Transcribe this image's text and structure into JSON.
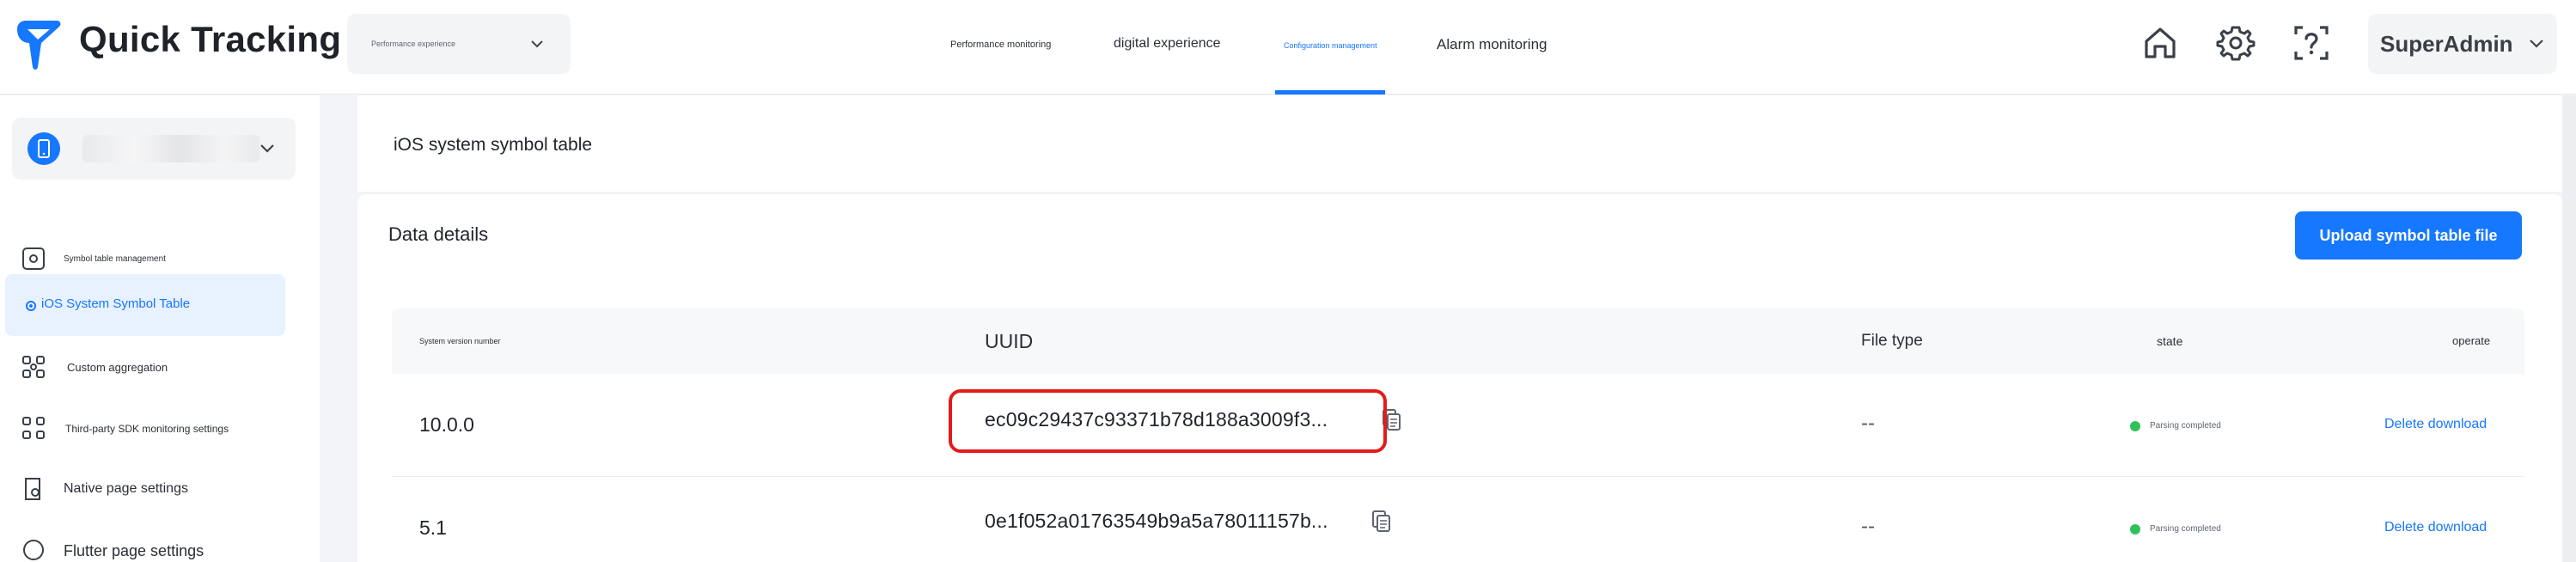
{
  "header": {
    "brand": "Quick Tracking",
    "env_select": "Performance experience",
    "nav": [
      {
        "label": "Performance monitoring"
      },
      {
        "label": "digital experience"
      },
      {
        "label": "Configuration management"
      },
      {
        "label": "Alarm monitoring"
      }
    ],
    "user": "SuperAdmin"
  },
  "sidebar": {
    "items": [
      {
        "label": "Symbol table management"
      },
      {
        "label": "iOS System Symbol Table"
      },
      {
        "label": "Custom aggregation"
      },
      {
        "label": "Third-party SDK monitoring settings"
      },
      {
        "label": "Native page settings"
      },
      {
        "label": "Flutter page settings"
      }
    ]
  },
  "main": {
    "page_title": "iOS system symbol table",
    "section_title": "Data details",
    "upload_label": "Upload symbol table file",
    "columns": {
      "version": "System version number",
      "uuid": "UUID",
      "file_type": "File type",
      "state": "state",
      "operate": "operate"
    },
    "rows": [
      {
        "version": "10.0.0",
        "uuid": "ec09c29437c93371b78d188a3009f3...",
        "file_type": "--",
        "state": "Parsing completed",
        "operate": "Delete download"
      },
      {
        "version": "5.1",
        "uuid": "0e1f052a01763549b9a5a78011157b...",
        "file_type": "--",
        "state": "Parsing completed",
        "operate": "Delete download"
      }
    ]
  },
  "colors": {
    "accent": "#1677ff",
    "success": "#2fc25b",
    "highlight": "#e31b1b"
  }
}
